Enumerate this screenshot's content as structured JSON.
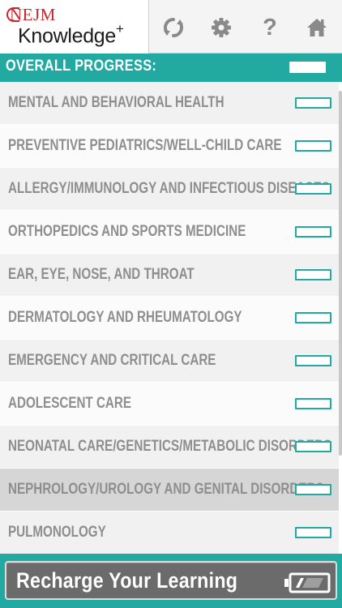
{
  "header": {
    "brand": "NEJM",
    "product": "Knowledge",
    "product_mark": "+",
    "icons": {
      "refresh": "refresh-icon",
      "settings": "gear-icon",
      "help": "question-icon",
      "home": "home-icon"
    },
    "help_glyph": "?"
  },
  "overall": {
    "label": "OVERALL PROGRESS:",
    "progress": 0
  },
  "topics": [
    {
      "label": "MENTAL AND BEHAVIORAL HEALTH",
      "progress": 0,
      "selected": false
    },
    {
      "label": "PREVENTIVE PEDIATRICS/WELL-CHILD CARE",
      "progress": 0,
      "selected": false
    },
    {
      "label": "ALLERGY/IMMUNOLOGY AND INFECTIOUS DISEASES",
      "progress": 0,
      "selected": false
    },
    {
      "label": "ORTHOPEDICS AND SPORTS MEDICINE",
      "progress": 0,
      "selected": false
    },
    {
      "label": "EAR, EYE, NOSE, AND THROAT",
      "progress": 0,
      "selected": false
    },
    {
      "label": "DERMATOLOGY AND RHEUMATOLOGY",
      "progress": 0,
      "selected": false
    },
    {
      "label": "EMERGENCY AND CRITICAL CARE",
      "progress": 0,
      "selected": false
    },
    {
      "label": "ADOLESCENT CARE",
      "progress": 0,
      "selected": false
    },
    {
      "label": "NEONATAL CARE/GENETICS/METABOLIC DISORDERS",
      "progress": 0,
      "selected": false
    },
    {
      "label": "NEPHROLOGY/UROLOGY AND GENITAL DISORDERS",
      "progress": 0,
      "selected": true
    },
    {
      "label": "PULMONOLOGY",
      "progress": 0,
      "selected": false
    }
  ],
  "footer": {
    "button_label": "Recharge Your Learning",
    "icon": "battery-icon"
  },
  "colors": {
    "accent": "#22a9a2",
    "brand_red": "#c9252c",
    "label_gray": "#8e8e8e",
    "icon_gray": "#8a8a8a"
  }
}
